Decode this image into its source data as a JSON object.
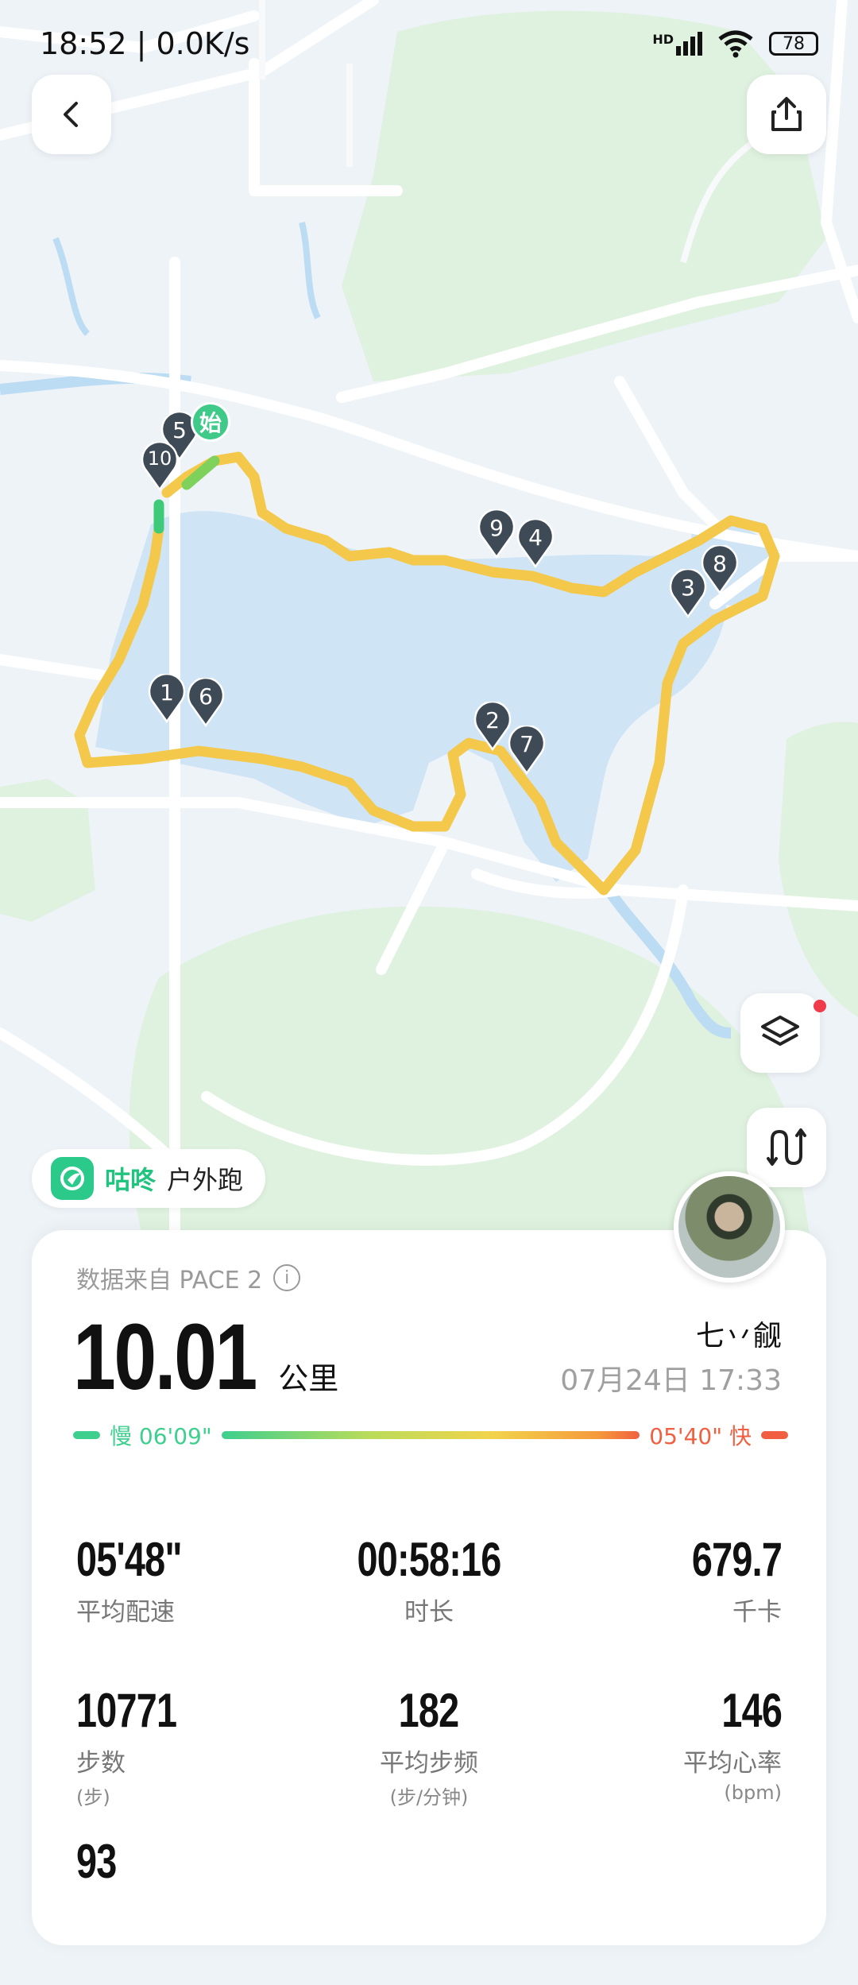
{
  "status_bar": {
    "time_speed": "18:52 | 0.0K/s",
    "network": "HD",
    "battery": "78"
  },
  "map": {
    "start_label": "始",
    "markers": [
      "1",
      "2",
      "3",
      "4",
      "5",
      "6",
      "7",
      "8",
      "9",
      "10"
    ],
    "route_color": "#f3c84b",
    "water_color": "#cfe4f5"
  },
  "app_tag": {
    "name": "咕咚",
    "type": "户外跑"
  },
  "summary": {
    "source": "数据来自 PACE 2",
    "distance": "10.01",
    "distance_unit": "公里",
    "username": "七丷觎",
    "datetime": "07月24日 17:33",
    "pace_slow": "慢 06'09\"",
    "pace_fast": "05'40\" 快"
  },
  "stats": [
    {
      "value": "05'48\"",
      "label": "平均配速",
      "unit": ""
    },
    {
      "value": "00:58:16",
      "label": "时长",
      "unit": ""
    },
    {
      "value": "679.7",
      "label": "千卡",
      "unit": ""
    },
    {
      "value": "10771",
      "label": "步数",
      "unit": "(步)"
    },
    {
      "value": "182",
      "label": "平均步频",
      "unit": "(步/分钟)"
    },
    {
      "value": "146",
      "label": "平均心率",
      "unit": "(bpm)"
    },
    {
      "value": "93",
      "label": "",
      "unit": ""
    }
  ]
}
